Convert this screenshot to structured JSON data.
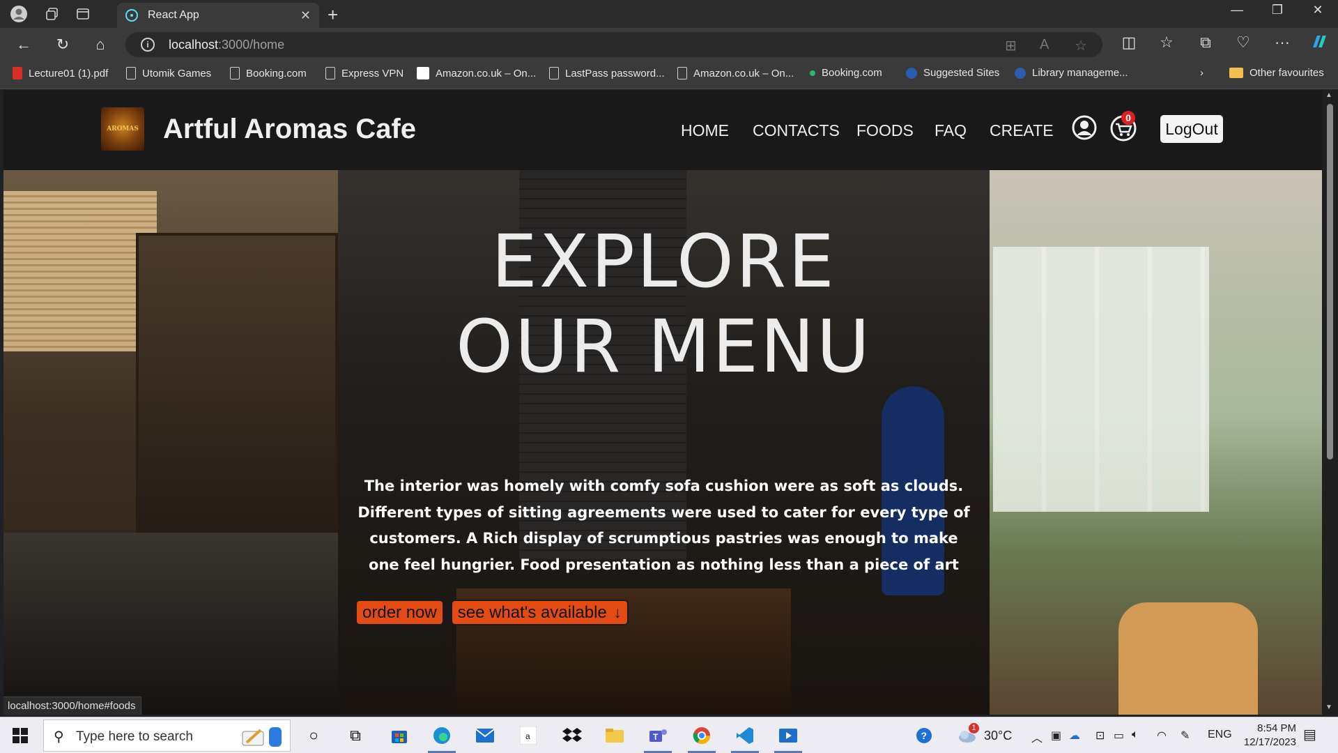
{
  "browser": {
    "tab_title": "React App",
    "url_host": "localhost",
    "url_rest": ":3000/home",
    "bookmarks": [
      "Lecture01 (1).pdf",
      "Utomik Games",
      "Booking.com",
      "Express VPN",
      "Amazon.co.uk – On...",
      "LastPass password...",
      "Amazon.co.uk – On...",
      "Booking.com",
      "Suggested Sites",
      "Library manageme...",
      "Other favourites"
    ]
  },
  "site": {
    "brand": "Artful Aromas Cafe",
    "logo_text": "AROMAS",
    "nav": [
      "HOME",
      "CONTACTS",
      "FOODS",
      "FAQ",
      "CREATE"
    ],
    "cart_count": "0",
    "logout_label": "LogOut"
  },
  "hero": {
    "title_line1": "EXPLORE",
    "title_line2": "OUR MENU",
    "description": "The interior was homely with comfy sofa cushion were as soft as clouds. Different types of sitting agreements were used to cater for every type of customers. A Rich display of scrumptious pastries was enough to make one feel hungrier. Food presentation as nothing less than a piece of art",
    "order_button": "order now",
    "available_button": "see what's available",
    "available_icon": "arrow-down-icon"
  },
  "status_bar": {
    "hover_url": "localhost:3000/home#foods"
  },
  "taskbar": {
    "search_placeholder": "Type here to search",
    "weather": "30°C",
    "weather_badge": "1",
    "language": "ENG",
    "time": "8:54 PM",
    "date": "12/17/2023"
  },
  "colors": {
    "accent_orange": "#e24b12",
    "navbar_bg": "#191919",
    "cart_badge": "#e02020"
  }
}
